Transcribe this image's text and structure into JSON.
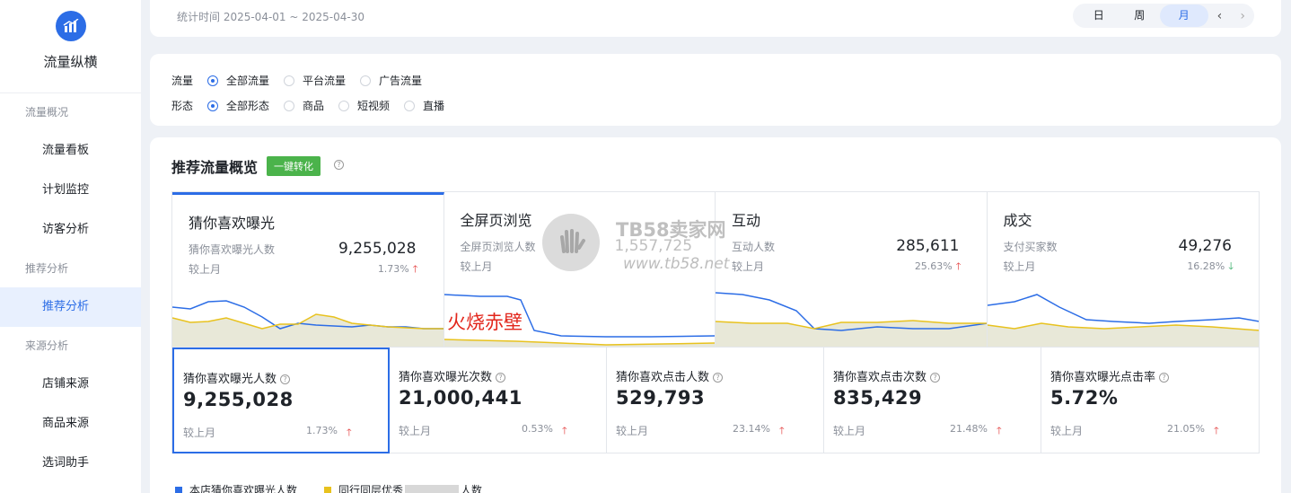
{
  "app": {
    "title": "流量纵横"
  },
  "sidebar": {
    "groups": [
      {
        "label": "流量概况",
        "items": [
          "流量看板",
          "计划监控",
          "访客分析"
        ]
      },
      {
        "label": "推荐分析",
        "items": [
          "推荐分析"
        ]
      },
      {
        "label": "来源分析",
        "items": [
          "店铺来源",
          "商品来源",
          "选词助手"
        ]
      }
    ],
    "active_item": "推荐分析"
  },
  "header": {
    "date_range": "统计时间 2025-04-01 ~ 2025-04-30",
    "periods": [
      "日",
      "周",
      "月"
    ],
    "active_period": "月",
    "prev_icon": "chevron-left-icon",
    "next_icon": "chevron-right-icon"
  },
  "filters": {
    "traffic": {
      "label": "流量",
      "options": [
        "全部流量",
        "平台流量",
        "广告流量"
      ],
      "selected": "全部流量"
    },
    "form": {
      "label": "形态",
      "options": [
        "全部形态",
        "商品",
        "短视频",
        "直播"
      ],
      "selected": "全部形态"
    }
  },
  "overview": {
    "title": "推荐流量概览",
    "convert_button": "一键转化",
    "panels": [
      {
        "title": "猜你喜欢曝光",
        "metric_label": "猜你喜欢曝光人数",
        "value": "9,255,028",
        "compare_label": "较上月",
        "change": "1.73%",
        "direction": "up"
      },
      {
        "title": "全屏页浏览",
        "metric_label": "全屏页浏览人数",
        "value": "1,557,725",
        "compare_label": "较上月",
        "change": "",
        "direction": "up"
      },
      {
        "title": "互动",
        "metric_label": "互动人数",
        "value": "285,611",
        "compare_label": "较上月",
        "change": "25.63%",
        "direction": "up"
      },
      {
        "title": "成交",
        "metric_label": "支付买家数",
        "value": "49,276",
        "compare_label": "较上月",
        "change": "16.28%",
        "direction": "down"
      }
    ],
    "metrics": [
      {
        "label": "猜你喜欢曝光人数",
        "value": "9,255,028",
        "compare_label": "较上月",
        "change": "1.73%"
      },
      {
        "label": "猜你喜欢曝光次数",
        "value": "21,000,441",
        "compare_label": "较上月",
        "change": "0.53%"
      },
      {
        "label": "猜你喜欢点击人数",
        "value": "529,793",
        "compare_label": "较上月",
        "change": "23.14%"
      },
      {
        "label": "猜你喜欢点击次数",
        "value": "835,429",
        "compare_label": "较上月",
        "change": "21.48%"
      },
      {
        "label": "猜你喜欢曝光点击率",
        "value": "5.72%",
        "compare_label": "较上月",
        "change": "21.05%"
      }
    ],
    "legend": [
      {
        "label": "本店猜你喜欢曝光人数",
        "color": "#2c6de6"
      },
      {
        "label": "同行同层优秀",
        "suffix": "人数",
        "color": "#e8c21e"
      }
    ]
  },
  "overlays": {
    "watermark_brand": "TB58卖家网",
    "watermark_url": "www.tb58.net",
    "red_text": "火烧赤壁"
  },
  "colors": {
    "accent": "#2c6de6",
    "up": "#e33b3b",
    "down": "#26a65b",
    "peer": "#e8c21e",
    "convert": "#4bb34b"
  }
}
